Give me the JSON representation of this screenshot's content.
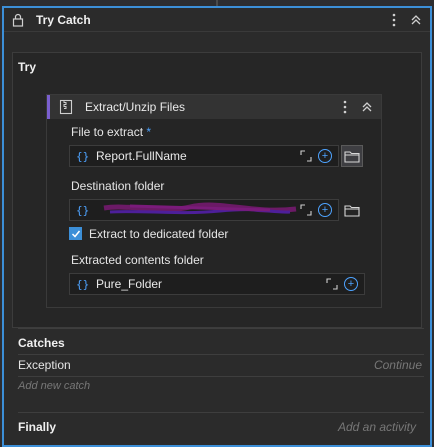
{
  "header": {
    "title": "Try Catch"
  },
  "try_section": {
    "label": "Try"
  },
  "activity": {
    "title": "Extract/Unzip Files",
    "file_to_extract": {
      "label": "File to extract",
      "required_marker": "*",
      "value": "Report.FullName"
    },
    "destination_folder": {
      "label": "Destination folder",
      "value": ""
    },
    "extract_to_dedicated": {
      "label": "Extract to dedicated folder",
      "checked": true
    },
    "extracted_contents_folder": {
      "label": "Extracted contents folder",
      "value": "Pure_Folder"
    }
  },
  "catches": {
    "label": "Catches",
    "exception": "Exception",
    "exception_action": "Continue",
    "add_new": "Add new catch"
  },
  "finally": {
    "label": "Finally",
    "add_activity": "Add an activity"
  },
  "icons": {
    "lock": "lock-icon",
    "more": "more-vertical-icon",
    "collapse": "chevrons-up-icon",
    "expand": "expand-icon",
    "plus": "plus-circle-icon",
    "folder": "folder-icon",
    "braces": "braces-icon"
  },
  "colors": {
    "accent": "#3c8fd8",
    "activity_bar": "#7a5fcf",
    "link": "#4ea3ff"
  }
}
